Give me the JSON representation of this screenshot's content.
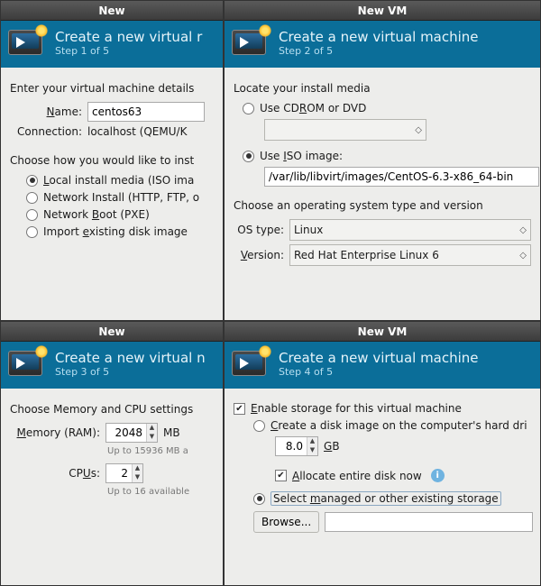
{
  "window_title": "New VM",
  "window_title_cut": "New",
  "header_title": "Create a new virtual machine",
  "header_title_cut1": "Create a new virtual r",
  "header_title_cut3": "Create a new virtual n",
  "steps": {
    "s1": "Step 1 of 5",
    "s2": "Step 2 of 5",
    "s3": "Step 3 of 5",
    "s4": "Step 4 of 5"
  },
  "step1": {
    "intro": "Enter your virtual machine details",
    "name_label_pre": "N",
    "name_label_post": "ame:",
    "name_value": "centos63",
    "conn_label": "Connection:",
    "conn_value": "localhost (QEMU/K",
    "choose": "Choose how you would like to inst",
    "opt_local_pre": "L",
    "opt_local": "ocal install media (ISO ima",
    "opt_net": "Network Install (HTTP, FTP, o",
    "opt_boot_pre": "Network ",
    "opt_boot_u": "B",
    "opt_boot_post": "oot (PXE)",
    "opt_import_pre": "Import ",
    "opt_import_u": "e",
    "opt_import_post": "xisting disk image"
  },
  "step2": {
    "locate": "Locate your install media",
    "use_cd_pre": "Use CD",
    "use_cd_u": "R",
    "use_cd_post": "OM or DVD",
    "use_iso_pre": "Use ",
    "use_iso_u": "I",
    "use_iso_post": "SO image:",
    "iso_path": "/var/lib/libvirt/images/CentOS-6.3-x86_64-bin",
    "choose_os": "Choose an operating system type and version",
    "os_type_label": "OS type:",
    "os_type_value": "Linux",
    "version_label_u": "V",
    "version_label_post": "ersion:",
    "version_value": "Red Hat Enterprise Linux 6"
  },
  "step3": {
    "heading": "Choose Memory and CPU settings",
    "mem_label_u": "M",
    "mem_label_post": "emory (RAM):",
    "mem_value": "2048",
    "mem_unit": "MB",
    "mem_hint": "Up to 15936 MB a",
    "cpu_label_pre": "CP",
    "cpu_label_u": "U",
    "cpu_label_post": "s:",
    "cpu_value": "2",
    "cpu_hint": "Up to 16 available"
  },
  "step4": {
    "enable_pre": "E",
    "enable_post": "nable storage for this virtual machine",
    "create_pre": "C",
    "create_post": "reate a disk image on the computer's hard dri",
    "size_value": "8.0",
    "size_unit_u": "G",
    "size_unit_post": "B",
    "alloc_pre": "A",
    "alloc_post": "llocate entire disk now",
    "select_pre": "Select ",
    "select_u": "m",
    "select_post": "anaged or other existing storage",
    "browse": "Browse..."
  }
}
